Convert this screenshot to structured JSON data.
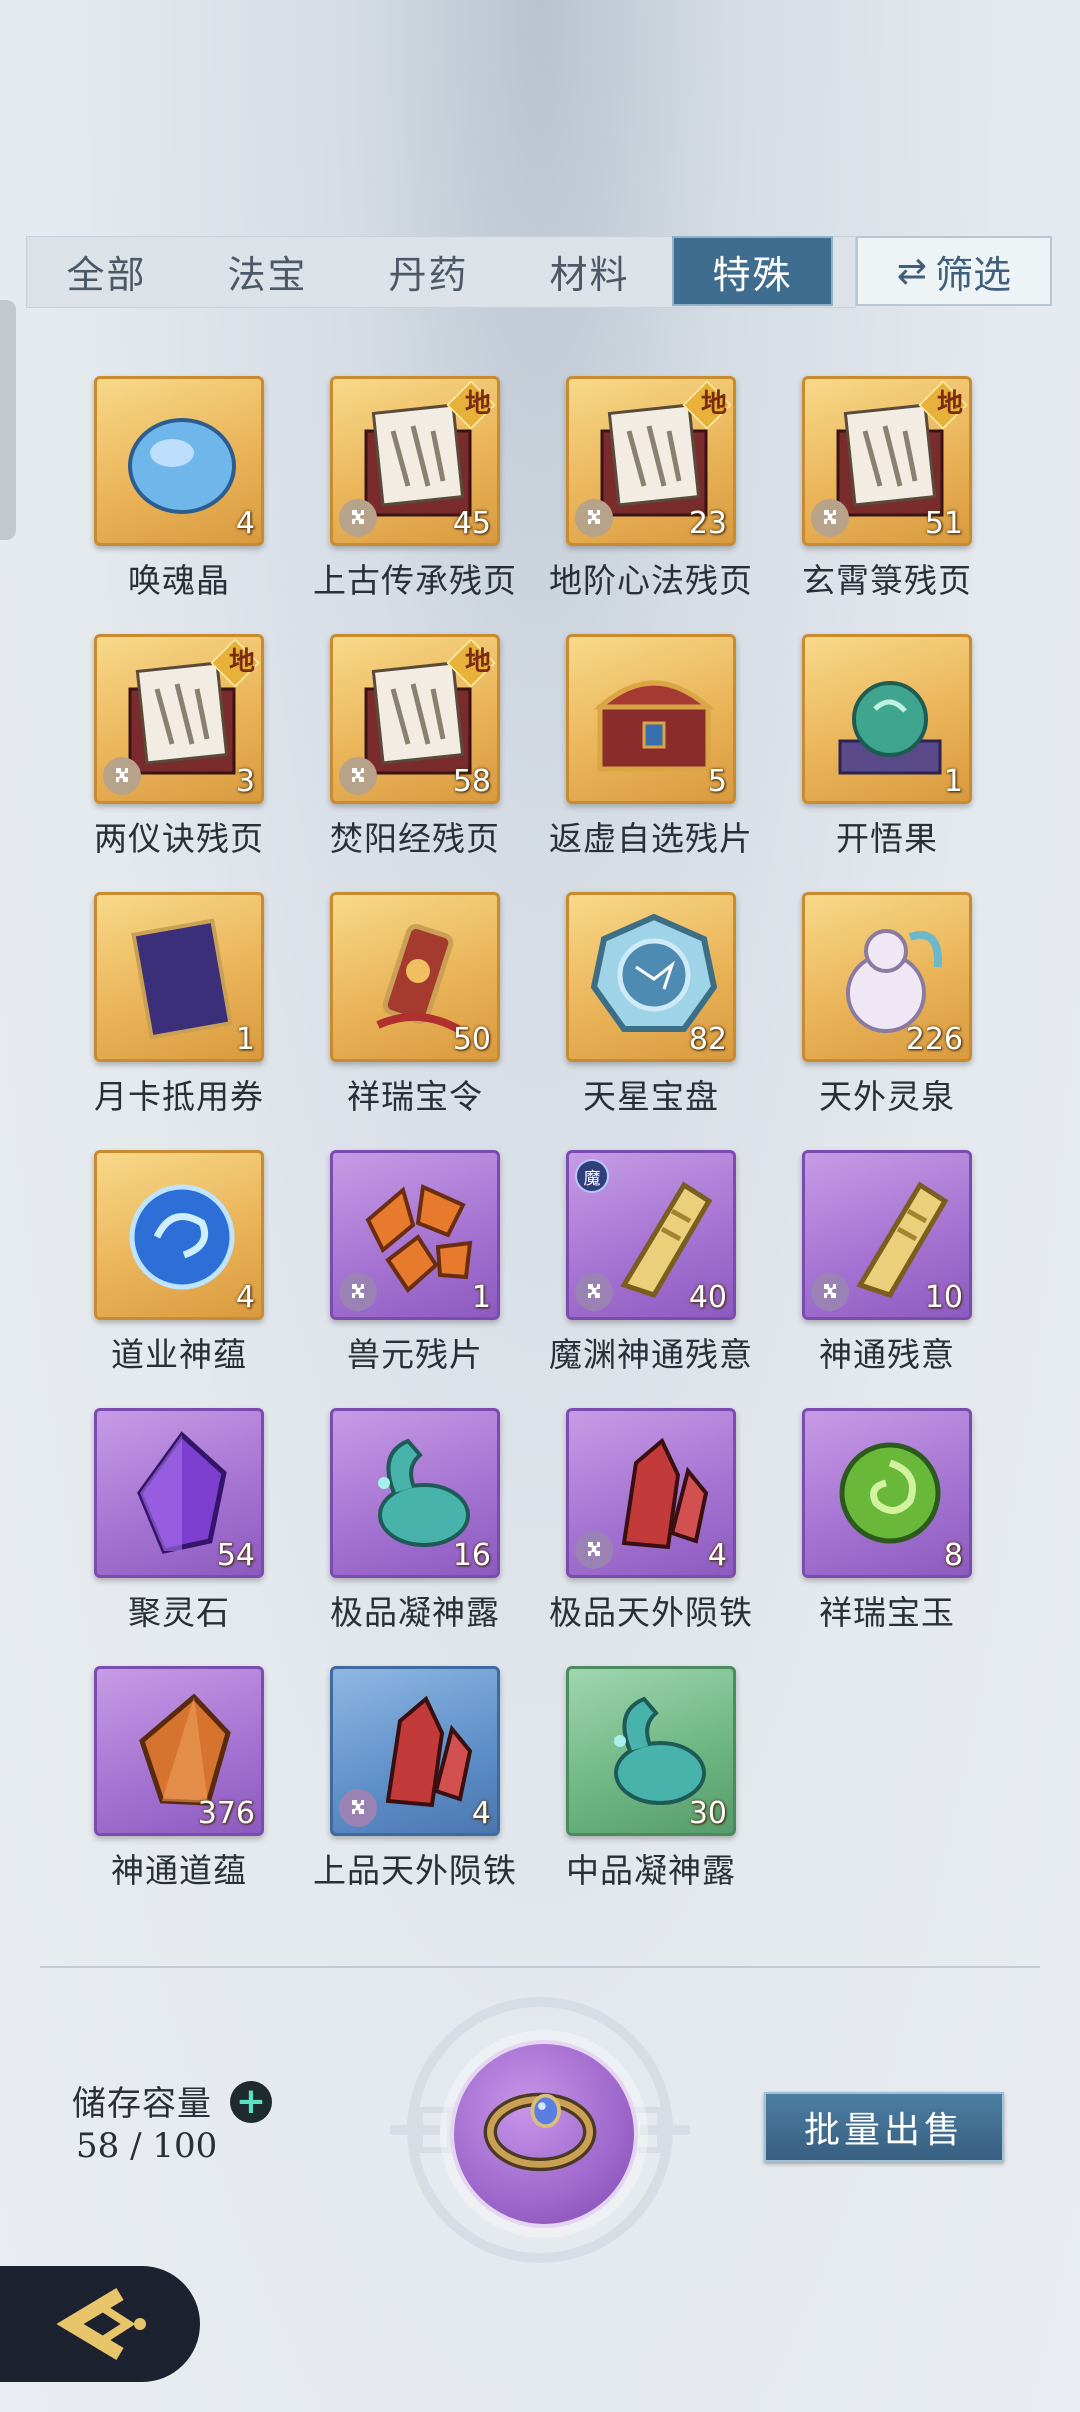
{
  "tabs": [
    {
      "label": "全部",
      "active": false
    },
    {
      "label": "法宝",
      "active": false
    },
    {
      "label": "丹药",
      "active": false
    },
    {
      "label": "材料",
      "active": false
    },
    {
      "label": "特殊",
      "active": true
    }
  ],
  "filter_label": "筛选",
  "items": [
    {
      "name": "唤魂晶",
      "count": "4",
      "rarity": "gold",
      "icon": "crystal-blue-icon"
    },
    {
      "name": "上古传承残页",
      "count": "45",
      "rarity": "gold",
      "grade": "地",
      "fragment": true,
      "icon": "scroll-page-icon"
    },
    {
      "name": "地阶心法残页",
      "count": "23",
      "rarity": "gold",
      "grade": "地",
      "fragment": true,
      "icon": "scroll-page-icon"
    },
    {
      "name": "玄霄箓残页",
      "count": "51",
      "rarity": "gold",
      "grade": "地",
      "fragment": true,
      "icon": "scroll-page-icon"
    },
    {
      "name": "两仪诀残页",
      "count": "3",
      "rarity": "gold",
      "grade": "地",
      "fragment": true,
      "icon": "scroll-page-icon"
    },
    {
      "name": "焚阳经残页",
      "count": "58",
      "rarity": "gold",
      "grade": "地",
      "fragment": true,
      "icon": "scroll-page-icon"
    },
    {
      "name": "返虚自选残片",
      "count": "5",
      "rarity": "gold",
      "icon": "treasure-chest-icon"
    },
    {
      "name": "开悟果",
      "count": "1",
      "rarity": "gold",
      "icon": "enlightenment-fruit-icon"
    },
    {
      "name": "月卡抵用券",
      "count": "1",
      "rarity": "gold",
      "icon": "moon-card-icon"
    },
    {
      "name": "祥瑞宝令",
      "count": "50",
      "rarity": "gold",
      "icon": "token-icon"
    },
    {
      "name": "天星宝盘",
      "count": "82",
      "rarity": "gold",
      "icon": "star-disc-icon"
    },
    {
      "name": "天外灵泉",
      "count": "226",
      "rarity": "gold",
      "icon": "spirit-gourd-icon"
    },
    {
      "name": "道业神蕴",
      "count": "4",
      "rarity": "gold",
      "icon": "swirl-orb-icon"
    },
    {
      "name": "兽元残片",
      "count": "1",
      "rarity": "purple",
      "fragment": true,
      "icon": "beast-shards-icon"
    },
    {
      "name": "魔渊神通残意",
      "count": "40",
      "rarity": "purple",
      "fragment": true,
      "badge": "魔",
      "icon": "golden-tablet-icon"
    },
    {
      "name": "神通残意",
      "count": "10",
      "rarity": "purple",
      "fragment": true,
      "icon": "golden-tablet-icon"
    },
    {
      "name": "聚灵石",
      "count": "54",
      "rarity": "purple",
      "icon": "purple-crystal-icon"
    },
    {
      "name": "极品凝神露",
      "count": "16",
      "rarity": "purple",
      "icon": "dew-flask-icon"
    },
    {
      "name": "极品天外陨铁",
      "count": "4",
      "rarity": "purple",
      "fragment": true,
      "icon": "meteor-iron-icon"
    },
    {
      "name": "祥瑞宝玉",
      "count": "8",
      "rarity": "purple",
      "icon": "jade-swirl-icon"
    },
    {
      "name": "神通道蕴",
      "count": "376",
      "rarity": "purple",
      "icon": "amber-crystal-icon"
    },
    {
      "name": "上品天外陨铁",
      "count": "4",
      "rarity": "blue",
      "fragment": true,
      "icon": "meteor-iron-icon"
    },
    {
      "name": "中品凝神露",
      "count": "30",
      "rarity": "green",
      "icon": "dew-flask-icon"
    }
  ],
  "storage": {
    "label": "储存容量",
    "value": "58 / 100"
  },
  "sell_label": "批量出售",
  "colors": {
    "active_tab": "#3f6d8f",
    "gold": "#eab459",
    "purple": "#a371d1",
    "blue": "#5d8fc8",
    "green": "#6cb581"
  }
}
